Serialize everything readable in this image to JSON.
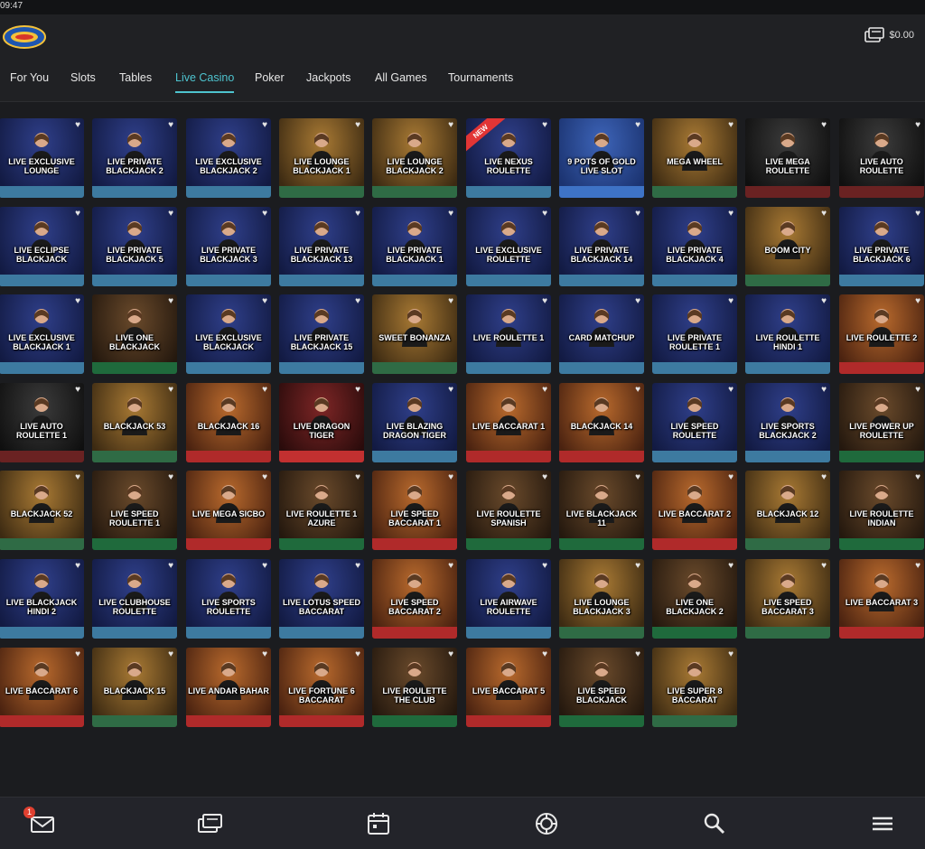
{
  "status": {
    "time": "09:47"
  },
  "wallet": {
    "balance": "$0.00"
  },
  "nav": {
    "tabs": [
      {
        "label": "For You",
        "active": false
      },
      {
        "label": "Slots",
        "active": false
      },
      {
        "label": "Tables",
        "active": false
      },
      {
        "label": "Live Casino",
        "active": true
      },
      {
        "label": "Poker",
        "active": false
      },
      {
        "label": "Jackpots",
        "active": false
      },
      {
        "label": "All Games",
        "active": false
      },
      {
        "label": "Tournaments",
        "active": false
      }
    ]
  },
  "bottom_nav": {
    "inbox_badge": "1",
    "icons": [
      "mail-icon",
      "cashier-icon",
      "calendar-icon",
      "promotions-chip-icon",
      "search-icon",
      "menu-icon"
    ]
  },
  "games": [
    {
      "label": "LIVE EXCLUSIVE LOUNGE",
      "theme": "blue"
    },
    {
      "label": "LIVE PRIVATE BLACKJACK 2",
      "theme": "blue"
    },
    {
      "label": "LIVE EXCLUSIVE BLACKJACK 2",
      "theme": "blue"
    },
    {
      "label": "LIVE LOUNGE BLACKJACK 1",
      "theme": "gold"
    },
    {
      "label": "LIVE LOUNGE BLACKJACK 2",
      "theme": "gold"
    },
    {
      "label": "LIVE NEXUS ROULETTE",
      "theme": "blue",
      "badge": "NEW"
    },
    {
      "label": "9 POTS OF GOLD LIVE SLOT",
      "theme": "slot"
    },
    {
      "label": "MEGA WHEEL",
      "theme": "gold"
    },
    {
      "label": "LIVE MEGA ROULETTE",
      "theme": "dark"
    },
    {
      "label": "LIVE AUTO ROULETTE",
      "theme": "dark"
    },
    {
      "label": "LIVE ECLIPSE BLACKJACK",
      "theme": "blue"
    },
    {
      "label": "LIVE PRIVATE BLACKJACK 5",
      "theme": "blue"
    },
    {
      "label": "LIVE PRIVATE BLACKJACK 3",
      "theme": "blue"
    },
    {
      "label": "LIVE PRIVATE BLACKJACK 13",
      "theme": "blue"
    },
    {
      "label": "LIVE PRIVATE BLACKJACK 1",
      "theme": "blue"
    },
    {
      "label": "LIVE EXCLUSIVE ROULETTE",
      "theme": "blue"
    },
    {
      "label": "LIVE PRIVATE BLACKJACK 14",
      "theme": "blue"
    },
    {
      "label": "LIVE PRIVATE BLACKJACK 4",
      "theme": "blue"
    },
    {
      "label": "BOOM CITY",
      "theme": "gold"
    },
    {
      "label": "LIVE PRIVATE BLACKJACK 6",
      "theme": "blue"
    },
    {
      "label": "LIVE EXCLUSIVE BLACKJACK 1",
      "theme": "blue"
    },
    {
      "label": "LIVE ONE BLACKJACK",
      "theme": "brown"
    },
    {
      "label": "LIVE EXCLUSIVE BLACKJACK",
      "theme": "blue"
    },
    {
      "label": "LIVE PRIVATE BLACKJACK 15",
      "theme": "blue"
    },
    {
      "label": "SWEET BONANZA",
      "theme": "gold"
    },
    {
      "label": "LIVE ROULETTE 1",
      "theme": "blue"
    },
    {
      "label": "CARD MATCHUP",
      "theme": "blue"
    },
    {
      "label": "LIVE PRIVATE ROULETTE 1",
      "theme": "blue"
    },
    {
      "label": "LIVE ROULETTE HINDI 1",
      "theme": "blue"
    },
    {
      "label": "LIVE ROULETTE 2",
      "theme": "orange"
    },
    {
      "label": "LIVE AUTO ROULETTE 1",
      "theme": "dark"
    },
    {
      "label": "BLACKJACK 53",
      "theme": "gold"
    },
    {
      "label": "BLACKJACK 16",
      "theme": "orange"
    },
    {
      "label": "LIVE DRAGON TIGER",
      "theme": "red"
    },
    {
      "label": "LIVE BLAZING DRAGON TIGER",
      "theme": "blue"
    },
    {
      "label": "LIVE BACCARAT 1",
      "theme": "orange"
    },
    {
      "label": "BLACKJACK 14",
      "theme": "orange"
    },
    {
      "label": "LIVE SPEED ROULETTE",
      "theme": "blue"
    },
    {
      "label": "LIVE SPORTS BLACKJACK 2",
      "theme": "blue"
    },
    {
      "label": "LIVE POWER UP ROULETTE",
      "theme": "brown"
    },
    {
      "label": "BLACKJACK 52",
      "theme": "gold"
    },
    {
      "label": "LIVE SPEED ROULETTE 1",
      "theme": "brown"
    },
    {
      "label": "LIVE MEGA SICBO",
      "theme": "orange"
    },
    {
      "label": "LIVE ROULETTE 1 AZURE",
      "theme": "brown"
    },
    {
      "label": "LIVE SPEED BACCARAT 1",
      "theme": "orange"
    },
    {
      "label": "LIVE ROULETTE SPANISH",
      "theme": "brown"
    },
    {
      "label": "LIVE BLACKJACK 11",
      "theme": "brown"
    },
    {
      "label": "LIVE BACCARAT 2",
      "theme": "orange"
    },
    {
      "label": "BLACKJACK 12",
      "theme": "gold"
    },
    {
      "label": "LIVE ROULETTE INDIAN",
      "theme": "brown"
    },
    {
      "label": "LIVE BLACKJACK HINDI 2",
      "theme": "blue"
    },
    {
      "label": "LIVE CLUBHOUSE ROULETTE",
      "theme": "blue"
    },
    {
      "label": "LIVE SPORTS ROULETTE",
      "theme": "blue"
    },
    {
      "label": "LIVE LOTUS SPEED BACCARAT",
      "theme": "blue"
    },
    {
      "label": "LIVE SPEED BACCARAT 2",
      "theme": "orange"
    },
    {
      "label": "LIVE AIRWAVE ROULETTE",
      "theme": "blue"
    },
    {
      "label": "LIVE LOUNGE BLACKJACK 3",
      "theme": "gold"
    },
    {
      "label": "LIVE ONE BLACKJACK 2",
      "theme": "brown"
    },
    {
      "label": "LIVE SPEED BACCARAT 3",
      "theme": "gold"
    },
    {
      "label": "LIVE BACCARAT 3",
      "theme": "orange"
    },
    {
      "label": "LIVE BACCARAT 6",
      "theme": "orange"
    },
    {
      "label": "BLACKJACK 15",
      "theme": "gold"
    },
    {
      "label": "LIVE ANDAR BAHAR",
      "theme": "orange"
    },
    {
      "label": "LIVE FORTUNE 6 BACCARAT",
      "theme": "orange"
    },
    {
      "label": "LIVE ROULETTE THE CLUB",
      "theme": "brown"
    },
    {
      "label": "LIVE BACCARAT 5",
      "theme": "orange"
    },
    {
      "label": "LIVE SPEED BLACKJACK",
      "theme": "brown"
    },
    {
      "label": "LIVE SUPER 8 BACCARAT",
      "theme": "gold"
    }
  ],
  "themes": {
    "blue": {
      "bg1": "#2f3f8a",
      "bg2": "#121a42",
      "felt": "#3d7aa0"
    },
    "gold": {
      "bg1": "#a97a34",
      "bg2": "#3c2a12",
      "felt": "#2f6b45"
    },
    "brown": {
      "bg1": "#6a4a2b",
      "bg2": "#24180e",
      "felt": "#1f6a3c"
    },
    "orange": {
      "bg1": "#b96a2d",
      "bg2": "#4a2210",
      "felt": "#b02a2a"
    },
    "red": {
      "bg1": "#7d2626",
      "bg2": "#2a0b0b",
      "felt": "#c23030"
    },
    "dark": {
      "bg1": "#3b3b3b",
      "bg2": "#0f0f0f",
      "felt": "#6a2222"
    },
    "slot": {
      "bg1": "#3d64b8",
      "bg2": "#1b3370",
      "felt": "#3e73c6"
    }
  },
  "colors": {
    "accent": "#4ec4cf",
    "background": "#1b1c1f",
    "bar": "#202124"
  }
}
